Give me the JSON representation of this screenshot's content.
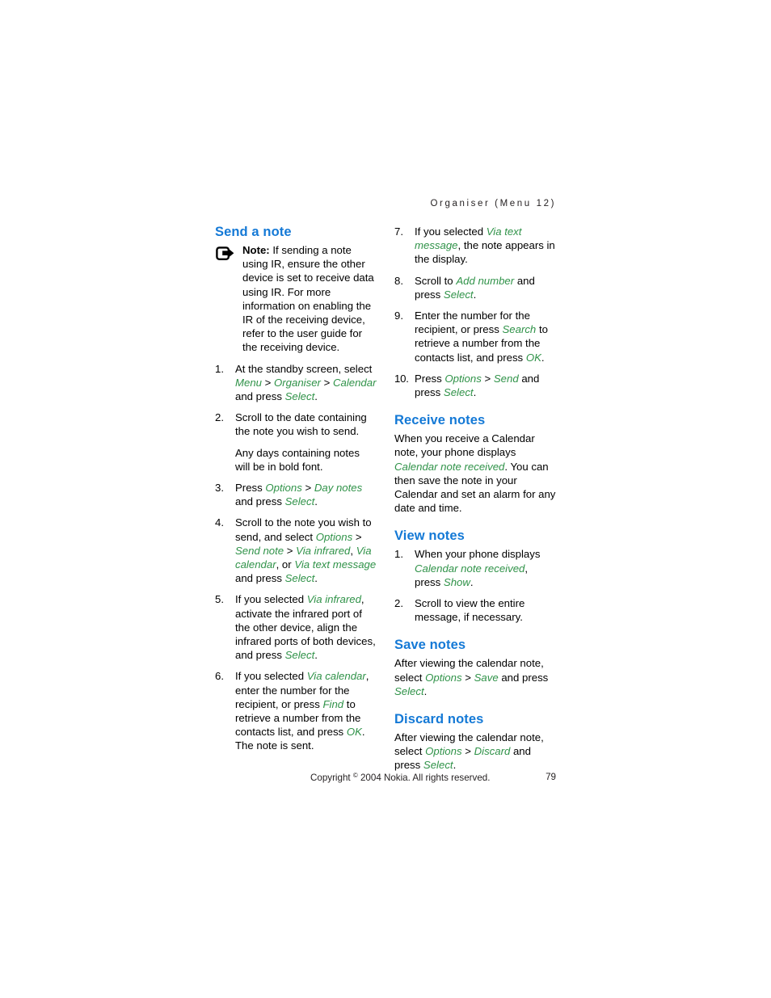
{
  "header": {
    "running_head": "Organiser (Menu 12)"
  },
  "left_column": {
    "heading": "Send a note",
    "note": {
      "icon": "note-send-arrow-icon",
      "label": "Note:",
      "text": " If sending a note using IR, ensure the other device is set to receive data using IR. For more information on enabling the IR of the receiving device, refer to the user guide for the receiving device."
    },
    "steps": [
      {
        "num": "1.",
        "parts": [
          {
            "t": "At the standby screen, select ",
            "s": "plain"
          },
          {
            "t": "Menu",
            "s": "ui"
          },
          {
            "t": " > ",
            "s": "plain"
          },
          {
            "t": "Organiser",
            "s": "ui"
          },
          {
            "t": " > ",
            "s": "plain"
          },
          {
            "t": "Calendar",
            "s": "ui"
          },
          {
            "t": " and press ",
            "s": "plain"
          },
          {
            "t": "Select",
            "s": "ui"
          },
          {
            "t": ".",
            "s": "plain"
          }
        ]
      },
      {
        "num": "2.",
        "parts": [
          {
            "t": "Scroll to the date containing the note you wish to send.",
            "s": "plain"
          }
        ],
        "sub": [
          {
            "t": "Any days containing notes will be in bold font.",
            "s": "plain"
          }
        ]
      },
      {
        "num": "3.",
        "parts": [
          {
            "t": "Press ",
            "s": "plain"
          },
          {
            "t": "Options",
            "s": "ui"
          },
          {
            "t": " > ",
            "s": "plain"
          },
          {
            "t": "Day notes",
            "s": "ui"
          },
          {
            "t": " and press ",
            "s": "plain"
          },
          {
            "t": "Select",
            "s": "ui"
          },
          {
            "t": ".",
            "s": "plain"
          }
        ]
      },
      {
        "num": "4.",
        "parts": [
          {
            "t": "Scroll to the note you wish to send, and select ",
            "s": "plain"
          },
          {
            "t": "Options",
            "s": "ui"
          },
          {
            "t": " > ",
            "s": "plain"
          },
          {
            "t": "Send note",
            "s": "ui"
          },
          {
            "t": " > ",
            "s": "plain"
          },
          {
            "t": "Via infrared",
            "s": "ui"
          },
          {
            "t": ", ",
            "s": "plain"
          },
          {
            "t": "Via calendar",
            "s": "ui"
          },
          {
            "t": ", or ",
            "s": "plain"
          },
          {
            "t": "Via text message",
            "s": "ui"
          },
          {
            "t": " and press ",
            "s": "plain"
          },
          {
            "t": "Select",
            "s": "ui"
          },
          {
            "t": ".",
            "s": "plain"
          }
        ]
      },
      {
        "num": "5.",
        "parts": [
          {
            "t": "If you selected ",
            "s": "plain"
          },
          {
            "t": "Via infrared",
            "s": "ui"
          },
          {
            "t": ", activate the infrared port of the other device, align the infrared ports of both devices, and press ",
            "s": "plain"
          },
          {
            "t": "Select",
            "s": "ui"
          },
          {
            "t": ".",
            "s": "plain"
          }
        ]
      },
      {
        "num": "6.",
        "parts": [
          {
            "t": "If you selected ",
            "s": "plain"
          },
          {
            "t": "Via calendar",
            "s": "ui"
          },
          {
            "t": ", enter the number for the recipient, or press ",
            "s": "plain"
          },
          {
            "t": "Find",
            "s": "ui"
          },
          {
            "t": " to retrieve a number from the contacts list, and press ",
            "s": "plain"
          },
          {
            "t": "OK",
            "s": "ui"
          },
          {
            "t": ". The note is sent.",
            "s": "plain"
          }
        ]
      }
    ]
  },
  "right_column": {
    "steps": [
      {
        "num": "7.",
        "parts": [
          {
            "t": "If you selected ",
            "s": "plain"
          },
          {
            "t": "Via text message",
            "s": "ui"
          },
          {
            "t": ", the note appears in the display.",
            "s": "plain"
          }
        ]
      },
      {
        "num": "8.",
        "parts": [
          {
            "t": "Scroll to ",
            "s": "plain"
          },
          {
            "t": "Add number",
            "s": "ui"
          },
          {
            "t": " and press ",
            "s": "plain"
          },
          {
            "t": "Select",
            "s": "ui"
          },
          {
            "t": ".",
            "s": "plain"
          }
        ]
      },
      {
        "num": "9.",
        "parts": [
          {
            "t": "Enter the number for the recipient, or press ",
            "s": "plain"
          },
          {
            "t": "Search",
            "s": "ui"
          },
          {
            "t": " to retrieve a number from the contacts list, and press ",
            "s": "plain"
          },
          {
            "t": "OK",
            "s": "ui"
          },
          {
            "t": ".",
            "s": "plain"
          }
        ]
      },
      {
        "num": "10.",
        "wide": true,
        "parts": [
          {
            "t": "Press ",
            "s": "plain"
          },
          {
            "t": "Options",
            "s": "ui"
          },
          {
            "t": " > ",
            "s": "plain"
          },
          {
            "t": "Send",
            "s": "ui"
          },
          {
            "t": " and press ",
            "s": "plain"
          },
          {
            "t": "Select",
            "s": "ui"
          },
          {
            "t": ".",
            "s": "plain"
          }
        ]
      }
    ],
    "sections": [
      {
        "heading": "Receive notes",
        "type": "para",
        "parts": [
          {
            "t": "When you receive a Calendar note, your phone displays ",
            "s": "plain"
          },
          {
            "t": "Calendar note received",
            "s": "ui"
          },
          {
            "t": ". You can then save the note in your Calendar and set an alarm for any date and time.",
            "s": "plain"
          }
        ]
      },
      {
        "heading": "View notes",
        "type": "steps",
        "steps": [
          {
            "num": "1.",
            "parts": [
              {
                "t": "When your phone displays ",
                "s": "plain"
              },
              {
                "t": "Calendar note received",
                "s": "ui"
              },
              {
                "t": ", press ",
                "s": "plain"
              },
              {
                "t": "Show",
                "s": "ui"
              },
              {
                "t": ".",
                "s": "plain"
              }
            ]
          },
          {
            "num": "2.",
            "parts": [
              {
                "t": "Scroll to view the entire message, if necessary.",
                "s": "plain"
              }
            ]
          }
        ]
      },
      {
        "heading": "Save notes",
        "type": "para",
        "parts": [
          {
            "t": "After viewing the calendar note, select ",
            "s": "plain"
          },
          {
            "t": "Options",
            "s": "ui"
          },
          {
            "t": " > ",
            "s": "plain"
          },
          {
            "t": "Save",
            "s": "ui"
          },
          {
            "t": " and press ",
            "s": "plain"
          },
          {
            "t": "Select",
            "s": "ui"
          },
          {
            "t": ".",
            "s": "plain"
          }
        ]
      },
      {
        "heading": "Discard notes",
        "type": "para",
        "parts": [
          {
            "t": "After viewing the calendar note, select ",
            "s": "plain"
          },
          {
            "t": "Options",
            "s": "ui"
          },
          {
            "t": " > ",
            "s": "plain"
          },
          {
            "t": "Discard",
            "s": "ui"
          },
          {
            "t": " and press ",
            "s": "plain"
          },
          {
            "t": "Select",
            "s": "ui"
          },
          {
            "t": ".",
            "s": "plain"
          }
        ]
      }
    ]
  },
  "footer": {
    "copyright_pre": "Copyright ",
    "copyright_sup": "©",
    "copyright_post": " 2004 Nokia. All rights reserved.",
    "page_number": "79"
  },
  "colors": {
    "heading_blue": "#1479d6",
    "ui_green": "#2f9248",
    "body_black": "#000000",
    "header_gray": "#231f20"
  }
}
